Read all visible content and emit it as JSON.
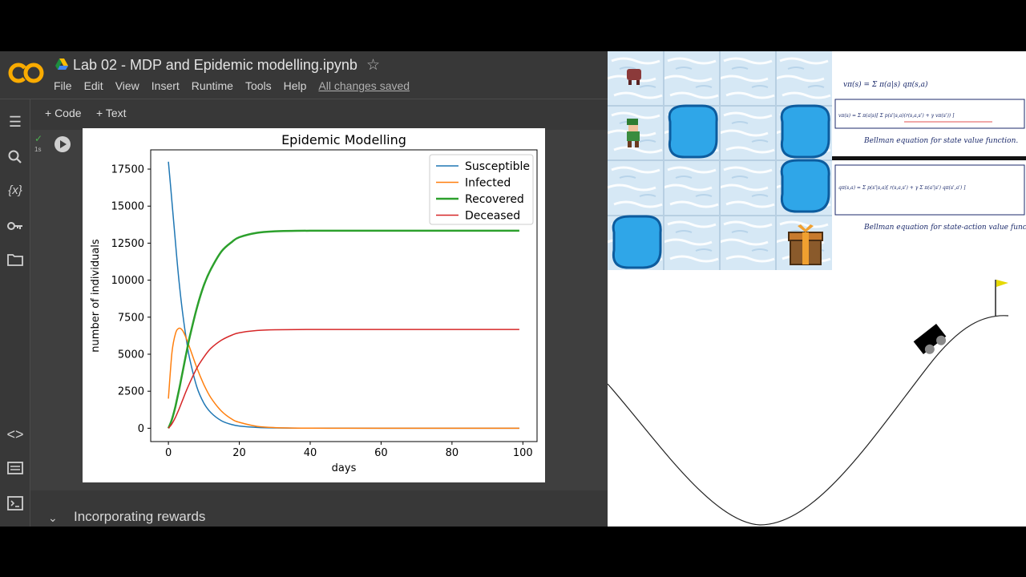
{
  "window": {
    "title": "Lab 02 - MDP and Epidemic modelling.ipynb",
    "logo_text": "CO",
    "menu": [
      "File",
      "Edit",
      "View",
      "Insert",
      "Runtime",
      "Tools",
      "Help"
    ],
    "save_status": "All changes saved"
  },
  "toolbar": {
    "code_label": "+ Code",
    "text_label": "+ Text"
  },
  "rail": {
    "icons": [
      "toc-icon",
      "search-icon",
      "variables-icon",
      "key-icon",
      "folder-icon",
      "code-snippets-icon",
      "command-palette-icon",
      "terminal-icon"
    ],
    "variables_glyph": "{x}"
  },
  "cell": {
    "exec_time": "1s"
  },
  "section": {
    "title": "Incorporating rewards"
  },
  "chart_data": {
    "type": "line",
    "title": "Epidemic Modelling",
    "xlabel": "days",
    "ylabel": "number of individuals",
    "xlim": [
      -5,
      104
    ],
    "ylim": [
      -900,
      18800
    ],
    "xticks": [
      0,
      20,
      40,
      60,
      80,
      100
    ],
    "yticks": [
      0,
      2500,
      5000,
      7500,
      10000,
      12500,
      15000,
      17500
    ],
    "legend_position": "top-right",
    "grid": false,
    "x": [
      0,
      1,
      2,
      3,
      4,
      5,
      6,
      8,
      10,
      12,
      15,
      18,
      20,
      25,
      30,
      40,
      50,
      60,
      70,
      80,
      90,
      99
    ],
    "series": [
      {
        "name": "Susceptible",
        "color": "#1f77b4",
        "width": 1.5,
        "values": [
          18000,
          15300,
          12500,
          9900,
          7800,
          6100,
          4700,
          2800,
          1700,
          1050,
          500,
          240,
          150,
          50,
          20,
          5,
          2,
          1,
          0,
          0,
          0,
          0
        ]
      },
      {
        "name": "Infected",
        "color": "#ff7f0e",
        "width": 1.5,
        "values": [
          2000,
          5100,
          6400,
          6750,
          6600,
          6100,
          5450,
          4100,
          2950,
          2050,
          1150,
          600,
          400,
          130,
          40,
          5,
          1,
          0,
          0,
          0,
          0,
          0
        ]
      },
      {
        "name": "Recovered",
        "color": "#2ca02c",
        "width": 2.5,
        "values": [
          0,
          600,
          1500,
          2600,
          3800,
          5000,
          6150,
          8100,
          9650,
          10750,
          11950,
          12600,
          12900,
          13200,
          13300,
          13340,
          13340,
          13340,
          13340,
          13340,
          13340,
          13340
        ]
      },
      {
        "name": "Deceased",
        "color": "#d62728",
        "width": 1.5,
        "values": [
          0,
          300,
          750,
          1300,
          1900,
          2500,
          3050,
          4050,
          4800,
          5400,
          5950,
          6300,
          6450,
          6600,
          6650,
          6670,
          6670,
          6670,
          6670,
          6670,
          6670,
          6670
        ]
      }
    ]
  },
  "notes": {
    "eq1": "vπ(s) = Σ π(a|s) qπ(s,a)",
    "eq2": "vπ(s) = Σ π(a|s)[ Σ p(s'|s,a)(r(s,a,s') + γ vπ(s')) ]",
    "caption1": "Bellman equation for state value function.",
    "eq3": "qπ(s,a) = Σ p(s'|s,a)[ r(s,a,s') + γ Σ π(a'|s') qπ(s',a') ]",
    "caption2": "Bellman equation for state-action value function"
  },
  "colors": {
    "colab_bg": "#383838",
    "logo_orange": "#f9ab00",
    "ice": "#cfe3f3",
    "hole": "#2fa6e8"
  }
}
